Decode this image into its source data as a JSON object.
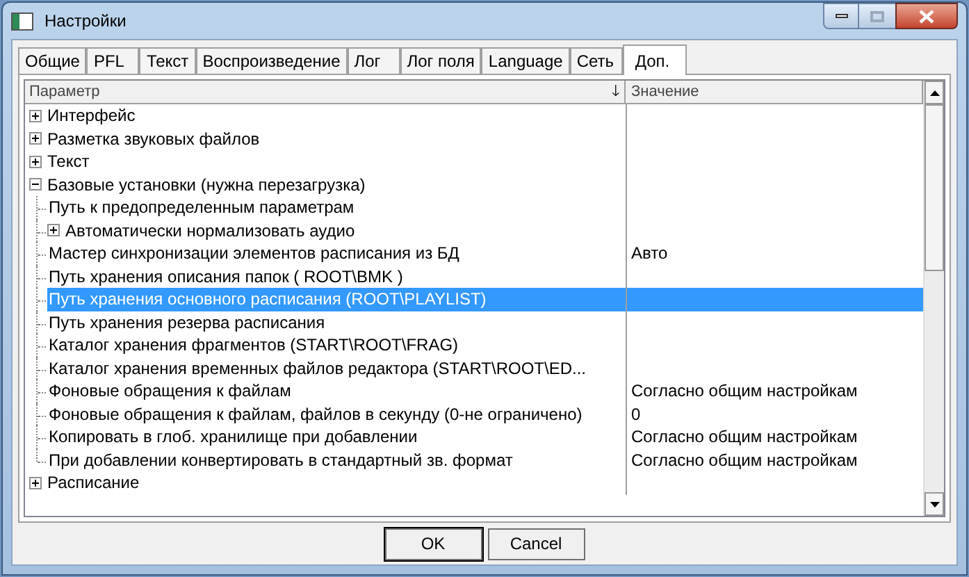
{
  "window": {
    "title": "Настройки"
  },
  "tabs": [
    {
      "label": "Общие",
      "selected": false
    },
    {
      "label": "PFL",
      "selected": false
    },
    {
      "label": "Текст",
      "selected": false
    },
    {
      "label": "Воспроизведение",
      "selected": false
    },
    {
      "label": "Лог",
      "selected": false
    },
    {
      "label": "Лог поля",
      "selected": false
    },
    {
      "label": "Language",
      "selected": false
    },
    {
      "label": "Сеть",
      "selected": false
    },
    {
      "label": "Доп.",
      "selected": true
    }
  ],
  "table": {
    "columns": [
      {
        "label": "Параметр",
        "sort_arrow": "🡓"
      },
      {
        "label": "Значение"
      }
    ],
    "rows": [
      {
        "label": "Интерфейс",
        "expanded": false,
        "selected": false
      },
      {
        "label": "Разметка звуковых файлов",
        "expanded": false,
        "selected": false
      },
      {
        "label": "Текст",
        "expanded": false,
        "selected": false
      },
      {
        "label": "Базовые установки (нужна перезагрузка)",
        "expanded": true,
        "selected": false,
        "children": [
          {
            "label": "Путь к предопределенным параметрам",
            "selected": false
          },
          {
            "label": "Автоматически нормализовать аудио",
            "expanded": false,
            "selected": false
          },
          {
            "label": "Мастер синхронизации элементов расписания из БД",
            "value": "Авто",
            "selected": false
          },
          {
            "label": "Путь хранения описания папок ( ROOT\\BMK )",
            "selected": false
          },
          {
            "label": "Путь хранения основного расписания (ROOT\\PLAYLIST)",
            "selected": true
          },
          {
            "label": "Путь хранения резерва расписания",
            "selected": false
          },
          {
            "label": "Каталог хранения фрагментов (START\\ROOT\\FRAG)",
            "selected": false
          },
          {
            "label": "Каталог хранения временных файлов редактора (START\\ROOT\\ED...",
            "selected": false
          },
          {
            "label": "Фоновые обращения к файлам",
            "value": "Согласно общим настройкам",
            "selected": false
          },
          {
            "label": "Фоновые обращения к файлам, файлов в секунду (0-не ограничено)",
            "value": "0",
            "selected": false
          },
          {
            "label": "Копировать в глоб. хранилище при добавлении",
            "value": "Согласно общим настройкам",
            "selected": false
          },
          {
            "label": "При добавлении конвертировать в стандартный зв. формат",
            "value": "Согласно общим настройкам",
            "selected": false
          }
        ]
      },
      {
        "label": "Расписание",
        "expanded": false,
        "selected": false
      }
    ]
  },
  "buttons": [
    "OK",
    "Cancel"
  ]
}
